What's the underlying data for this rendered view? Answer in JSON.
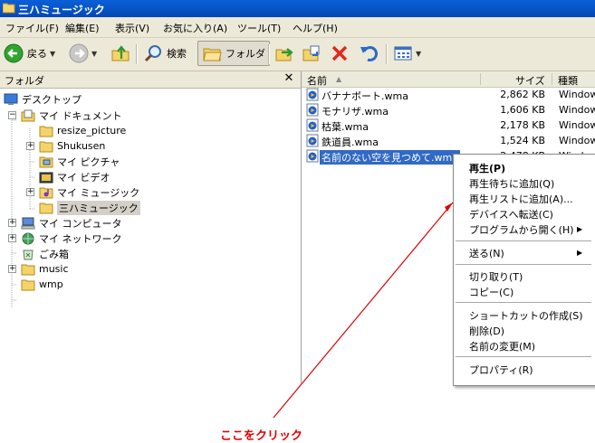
{
  "window": {
    "title": "三ハミュージック"
  },
  "menu": [
    "ファイル(F)",
    "編集(E)",
    "表示(V)",
    "お気に入り(A)",
    "ツール(T)",
    "ヘルプ(H)"
  ],
  "toolbar": {
    "back": "戻る",
    "search": "検索",
    "folders": "フォルダ"
  },
  "folder_pane": {
    "title": "フォルダ",
    "tree": [
      {
        "label": "デスクトップ",
        "icon": "desktop-icon"
      },
      {
        "label": "マイ ドキュメント",
        "icon": "my-documents-icon",
        "expander": "minus"
      },
      {
        "label": "resize_picture",
        "icon": "folder-icon"
      },
      {
        "label": "Shukusen",
        "icon": "folder-icon",
        "expander": "plus"
      },
      {
        "label": "マイ ピクチャ",
        "icon": "my-pictures-icon"
      },
      {
        "label": "マイ ビデオ",
        "icon": "my-videos-icon"
      },
      {
        "label": "マイ ミュージック",
        "icon": "my-music-icon",
        "expander": "plus"
      },
      {
        "label": "三ハミュージック",
        "icon": "folder-icon",
        "selected": true
      },
      {
        "label": "マイ コンピュータ",
        "icon": "my-computer-icon",
        "expander": "plus"
      },
      {
        "label": "マイ ネットワーク",
        "icon": "my-network-icon",
        "expander": "plus"
      },
      {
        "label": "ごみ箱",
        "icon": "recycle-bin-icon"
      },
      {
        "label": "music",
        "icon": "folder-icon",
        "expander": "plus"
      },
      {
        "label": "wmp",
        "icon": "folder-icon"
      }
    ]
  },
  "file_list": {
    "columns": {
      "name": "名前",
      "size": "サイズ",
      "type": "種類"
    },
    "rows": [
      {
        "name": "バナナボート.wma",
        "size": "2,862 KB",
        "type": "Windows"
      },
      {
        "name": "モナリザ.wma",
        "size": "1,606 KB",
        "type": "Windows"
      },
      {
        "name": "枯葉.wma",
        "size": "2,178 KB",
        "type": "Windows"
      },
      {
        "name": "鉄道員.wma",
        "size": "1,524 KB",
        "type": "Windows"
      },
      {
        "name": "名前のない空を見つめて.wma",
        "size": "2,478 KB",
        "type": "Windows",
        "selected": true
      }
    ]
  },
  "context_menu": {
    "items": [
      "再生(P)",
      "再生待ちに追加(Q)",
      "再生リストに追加(A)...",
      "デバイスへ転送(C)",
      "プログラムから開く(H)",
      "送る(N)",
      "切り取り(T)",
      "コピー(C)",
      "ショートカットの作成(S)",
      "削除(D)",
      "名前の変更(M)",
      "プロパティ(R)"
    ]
  },
  "annotation": {
    "text": "ここをクリック",
    "color": "#e00000"
  }
}
